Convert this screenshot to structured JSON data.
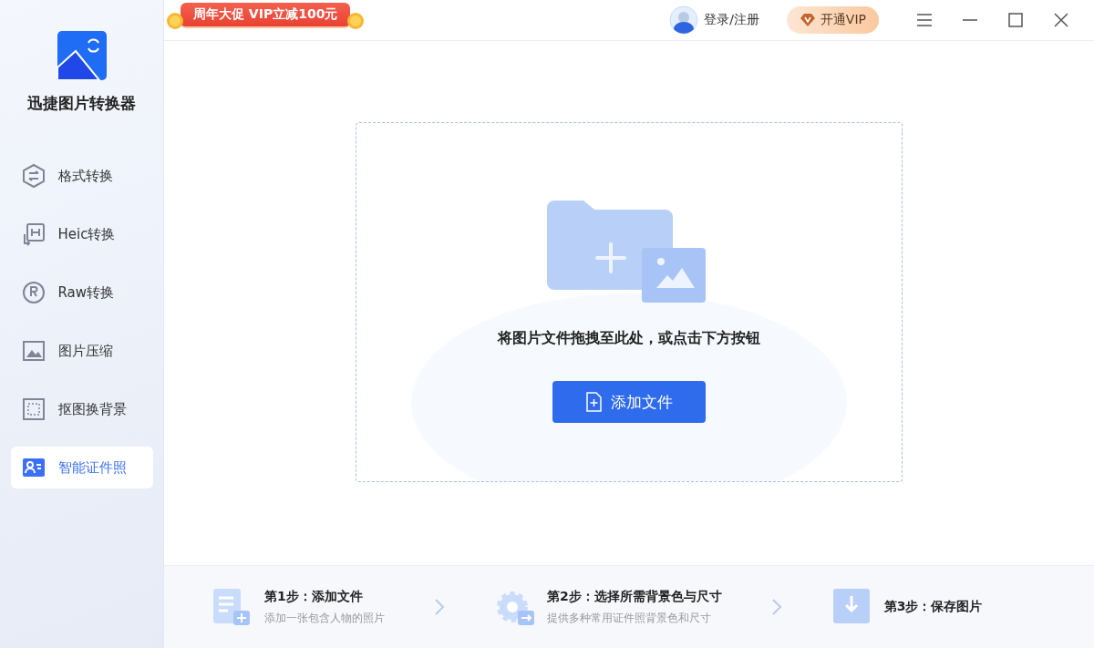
{
  "app": {
    "name": "迅捷图片转换器"
  },
  "promo": {
    "label": "周年大促 VIP立减100元"
  },
  "topbar": {
    "login": "登录/注册",
    "vip": "开通VIP"
  },
  "sidebar": {
    "items": [
      {
        "label": "格式转换",
        "selected": false
      },
      {
        "label": "Heic转换",
        "selected": false
      },
      {
        "label": "Raw转换",
        "selected": false
      },
      {
        "label": "图片压缩",
        "selected": false
      },
      {
        "label": "抠图换背景",
        "selected": false
      },
      {
        "label": "智能证件照",
        "selected": true
      }
    ]
  },
  "dropzone": {
    "hint": "将图片文件拖拽至此处，或点击下方按钮",
    "button": "添加文件"
  },
  "steps": [
    {
      "title": "第1步：添加文件",
      "desc": "添加一张包含人物的照片"
    },
    {
      "title": "第2步：选择所需背景色与尺寸",
      "desc": "提供多种常用证件照背景色和尺寸"
    },
    {
      "title": "第3步：保存图片"
    }
  ]
}
